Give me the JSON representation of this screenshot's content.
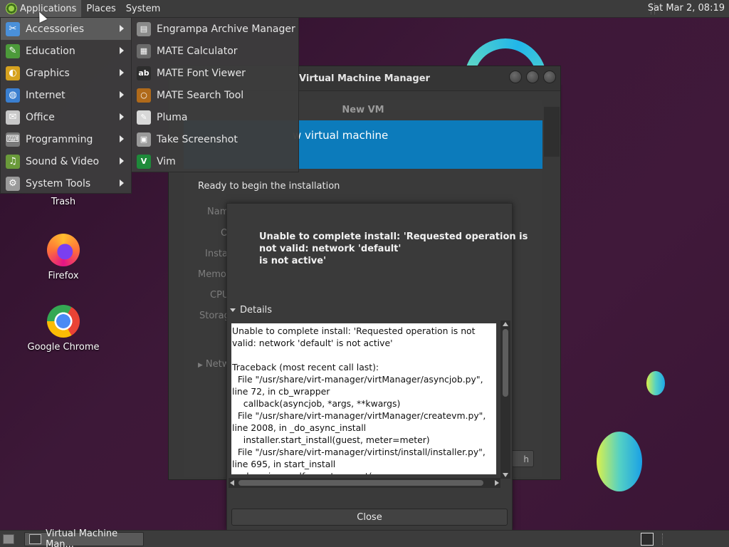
{
  "top_panel": {
    "applications": "Applications",
    "places": "Places",
    "system": "System",
    "clock": "Sat Mar  2, 08:19"
  },
  "apps_menu": {
    "items": [
      {
        "label": "Accessories",
        "icon": "accessories-icon",
        "color": "#4a90d9"
      },
      {
        "label": "Education",
        "icon": "education-icon",
        "color": "#4c9a3a"
      },
      {
        "label": "Graphics",
        "icon": "graphics-icon",
        "color": "#d6a21f"
      },
      {
        "label": "Internet",
        "icon": "internet-icon",
        "color": "#3a7fd0"
      },
      {
        "label": "Office",
        "icon": "office-icon",
        "color": "#c7c7c7"
      },
      {
        "label": "Programming",
        "icon": "programming-icon",
        "color": "#7a7a7a"
      },
      {
        "label": "Sound & Video",
        "icon": "sound-video-icon",
        "color": "#6a9a3a"
      },
      {
        "label": "System Tools",
        "icon": "system-tools-icon",
        "color": "#9a9a9a"
      }
    ]
  },
  "submenu": {
    "items": [
      {
        "label": "Engrampa Archive Manager",
        "icon": "archive-icon",
        "color": "#8a8a8a",
        "glyph": "▤"
      },
      {
        "label": "MATE Calculator",
        "icon": "calculator-icon",
        "color": "#6a6a6a",
        "glyph": "▦"
      },
      {
        "label": "MATE Font Viewer",
        "icon": "font-viewer-icon",
        "color": "#2d2d2d",
        "glyph": "ab"
      },
      {
        "label": "MATE Search Tool",
        "icon": "search-tool-icon",
        "color": "#b06a1a",
        "glyph": "○"
      },
      {
        "label": "Pluma",
        "icon": "pluma-icon",
        "color": "#d8d8d8",
        "glyph": "✎"
      },
      {
        "label": "Take Screenshot",
        "icon": "screenshot-icon",
        "color": "#9a9a9a",
        "glyph": "▣"
      },
      {
        "label": "Vim",
        "icon": "vim-icon",
        "color": "#1e8a3a",
        "glyph": "V"
      }
    ]
  },
  "desktop": {
    "trash": "Trash",
    "firefox": "Firefox",
    "chrome": "Google Chrome"
  },
  "vm_window": {
    "title": "Virtual Machine Manager",
    "dialog_title": "New VM",
    "banner": "w virtual machine",
    "ready": "Ready to begin the installation",
    "labels": [
      "Nam",
      "O",
      "Insta",
      "Memo",
      "CPU",
      "Storag",
      "Netw"
    ],
    "finish": "h"
  },
  "error_dialog": {
    "message_lines": [
      "Unable to complete install: 'Requested operation is",
      "not valid: network 'default'",
      "is not active'"
    ],
    "details_label": "Details",
    "details_text": "Unable to complete install: 'Requested operation is not valid: network 'default' is not active'\n\nTraceback (most recent call last):\n  File \"/usr/share/virt-manager/virtManager/asyncjob.py\", line 72, in cb_wrapper\n    callback(asyncjob, *args, **kwargs)\n  File \"/usr/share/virt-manager/virtManager/createvm.py\", line 2008, in _do_async_install\n    installer.start_install(guest, meter=meter)\n  File \"/usr/share/virt-manager/virtinst/install/installer.py\", line 695, in start_install\n    domain = self._create_guest(",
    "close_label": "Close"
  },
  "taskbar": {
    "task_label": "Virtual Machine Man..."
  }
}
